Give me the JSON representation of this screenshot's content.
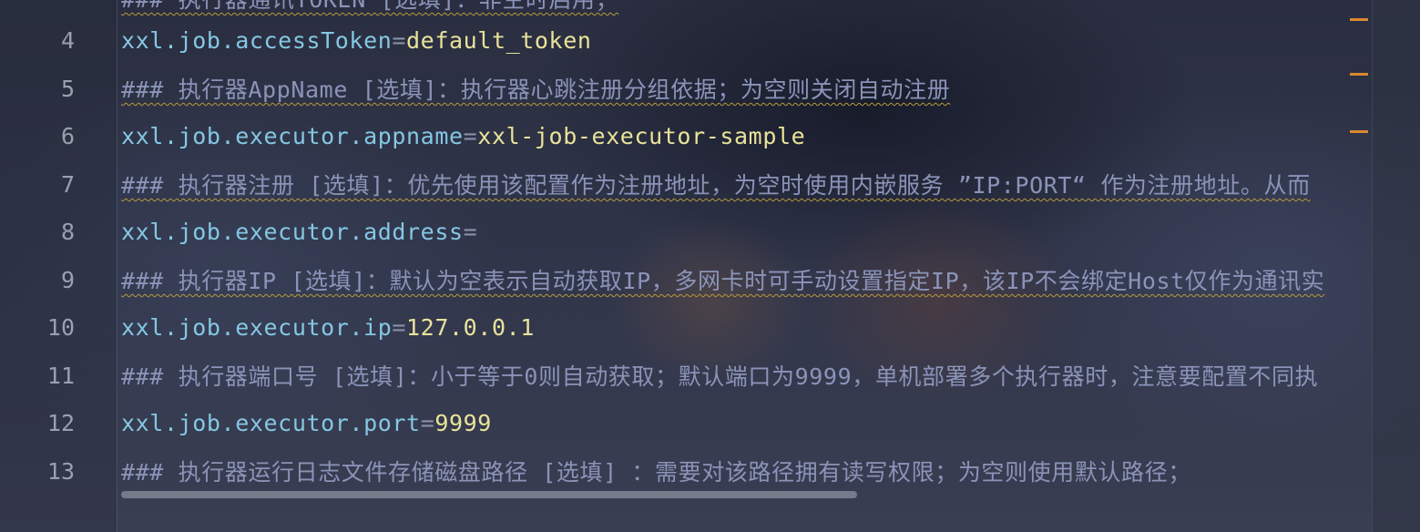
{
  "editor": {
    "lines": [
      {
        "num": "",
        "type": "comment",
        "comment": "### 执行器通讯TOKEN [选填]：非空时启用；"
      },
      {
        "num": "4",
        "type": "kv",
        "key": "xxl.job.accessToken",
        "eq": "=",
        "val": "default_token"
      },
      {
        "num": "5",
        "type": "comment",
        "comment": "### 执行器AppName [选填]：执行器心跳注册分组依据；为空则关闭自动注册"
      },
      {
        "num": "6",
        "type": "kv",
        "key": "xxl.job.executor.appname",
        "eq": "=",
        "val": "xxl-job-executor-sample"
      },
      {
        "num": "7",
        "type": "comment",
        "comment": "### 执行器注册 [选填]：优先使用该配置作为注册地址，为空时使用内嵌服务 ”IP:PORT“ 作为注册地址。从而"
      },
      {
        "num": "8",
        "type": "kv",
        "key": "xxl.job.executor.address",
        "eq": "=",
        "val": ""
      },
      {
        "num": "9",
        "type": "comment",
        "comment": "### 执行器IP [选填]：默认为空表示自动获取IP，多网卡时可手动设置指定IP，该IP不会绑定Host仅作为通讯实"
      },
      {
        "num": "10",
        "type": "kv",
        "key": "xxl.job.executor.ip",
        "eq": "=",
        "val": "127.0.0.1"
      },
      {
        "num": "11",
        "type": "comment",
        "comment": "### 执行器端口号 [选填]：小于等于0则自动获取；默认端口为9999，单机部署多个执行器时，注意要配置不同执"
      },
      {
        "num": "12",
        "type": "kv",
        "key": "xxl.job.executor.port",
        "eq": "=",
        "val": "9999"
      },
      {
        "num": "13",
        "type": "comment",
        "comment": "### 执行器运行日志文件存储磁盘路径 [选填] ：需要对该路径拥有读写权限；为空则使用默认路径；"
      }
    ]
  },
  "colors": {
    "key": "#85c7e3",
    "value": "#e9e39a",
    "comment": "#8b94b8",
    "line_number": "#9aa0b0",
    "marker": "#d98a2e"
  }
}
